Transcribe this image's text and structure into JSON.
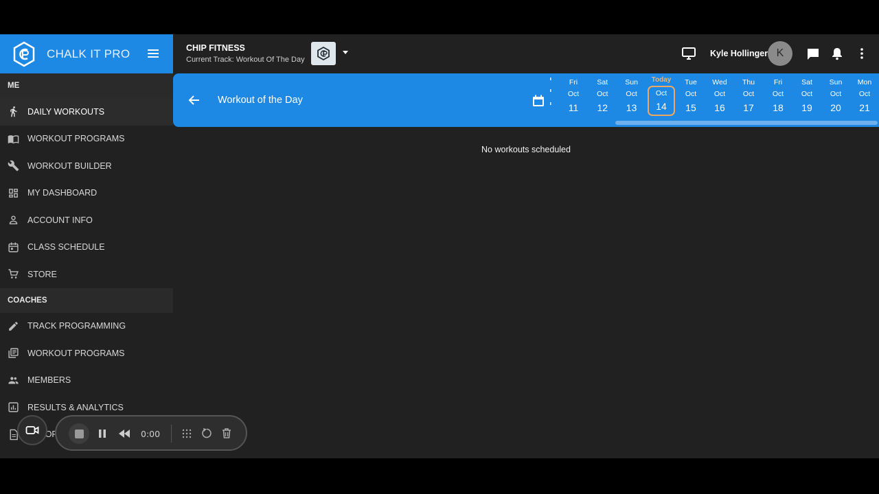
{
  "brand": {
    "name": "CHALK IT PRO"
  },
  "sidebar": {
    "sections": [
      {
        "heading": "ME",
        "items": [
          {
            "label": "DAILY WORKOUTS",
            "icon": "runner-icon",
            "active": true
          },
          {
            "label": "WORKOUT PROGRAMS",
            "icon": "book-icon"
          },
          {
            "label": "WORKOUT BUILDER",
            "icon": "wrench-icon"
          },
          {
            "label": "MY DASHBOARD",
            "icon": "dashboard-icon"
          },
          {
            "label": "ACCOUNT INFO",
            "icon": "person-icon"
          },
          {
            "label": "CLASS SCHEDULE",
            "icon": "calendar-icon"
          },
          {
            "label": "STORE",
            "icon": "cart-icon"
          }
        ]
      },
      {
        "heading": "COACHES",
        "items": [
          {
            "label": "TRACK PROGRAMMING",
            "icon": "pencil-icon"
          },
          {
            "label": "WORKOUT PROGRAMS",
            "icon": "library-icon"
          },
          {
            "label": "MEMBERS",
            "icon": "people-icon"
          },
          {
            "label": "RESULTS & ANALYTICS",
            "icon": "analytics-icon"
          },
          {
            "label": "REPORTS",
            "icon": "report-icon"
          }
        ]
      }
    ]
  },
  "header": {
    "gym_name": "CHIP FITNESS",
    "current_track": "Current Track: Workout Of The Day",
    "user_name": "Kyle Hollinger",
    "avatar_initial": "K"
  },
  "datebar": {
    "title": "Workout of the Day",
    "today_label": "Today",
    "days": [
      {
        "dow": "Fri",
        "month": "Oct",
        "day": "11"
      },
      {
        "dow": "Sat",
        "month": "Oct",
        "day": "12"
      },
      {
        "dow": "Sun",
        "month": "Oct",
        "day": "13"
      },
      {
        "dow": "",
        "month": "Oct",
        "day": "14",
        "today": true
      },
      {
        "dow": "Tue",
        "month": "Oct",
        "day": "15"
      },
      {
        "dow": "Wed",
        "month": "Oct",
        "day": "16"
      },
      {
        "dow": "Thu",
        "month": "Oct",
        "day": "17"
      },
      {
        "dow": "Fri",
        "month": "Oct",
        "day": "18"
      },
      {
        "dow": "Sat",
        "month": "Oct",
        "day": "19"
      },
      {
        "dow": "Sun",
        "month": "Oct",
        "day": "20"
      },
      {
        "dow": "Mon",
        "month": "Oct",
        "day": "21"
      }
    ]
  },
  "main": {
    "empty_message": "No workouts scheduled"
  },
  "recorder": {
    "time": "0:00"
  },
  "colors": {
    "accent": "#1e88e5",
    "today_outline": "#f0a860",
    "background": "#212121"
  }
}
